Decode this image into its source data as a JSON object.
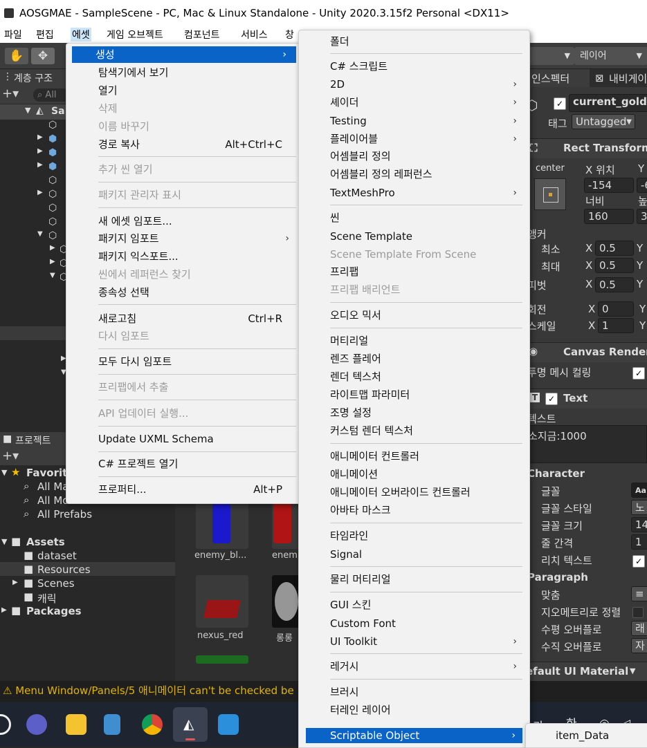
{
  "window": {
    "title": "AOSGMAE - SampleScene - PC, Mac & Linux Standalone - Unity 2020.3.15f2 Personal <DX11>"
  },
  "menubar": [
    "파일",
    "편집",
    "에셋",
    "게임 오브젝트",
    "컴포넌트",
    "서비스",
    "창"
  ],
  "toolbar": {
    "layers_label": "레이어"
  },
  "hierarchy": {
    "tab": "계층 구조",
    "search_placeholder": "All",
    "scene_name": "Sa"
  },
  "project": {
    "tab": "프로젝트",
    "favorites": "Favorit",
    "fav_items": [
      "All Ma",
      "All Models",
      "All Prefabs"
    ],
    "assets": "Assets",
    "asset_items": [
      "dataset",
      "Resources",
      "Scenes",
      "캐릭"
    ],
    "packages": "Packages",
    "thumbs": [
      "enemy_bl...",
      "enem",
      "nexus_red",
      "롱롱"
    ]
  },
  "status": {
    "message": "Menu Window/Panels/5 애니메이터  can't be checked be"
  },
  "inspector": {
    "tab_inspector": "인스펙터",
    "tab_navigation": "내비게이",
    "object_name": "current_gold",
    "tag_label": "태그",
    "tag_value": "Untagged",
    "rect_transform": "Rect Transform",
    "anchor_preset": "center",
    "pos_x_label": "X 위치",
    "pos_y_label": "Y",
    "pos_x": "-154",
    "pos_y": "-6",
    "width_label": "너비",
    "height_label": "높",
    "width": "160",
    "height": "3",
    "anchors": "앵커",
    "min": "최소",
    "max": "최대",
    "pivot": "피벗",
    "rotation": "회전",
    "scale": "스케일",
    "x_letter": "X",
    "y_letter": "Y",
    "anchor_min_x": "0.5",
    "anchor_max_x": "0.5",
    "pivot_x": "0.5",
    "rotation_x": "0",
    "scale_x": "1",
    "canvas_renderer": "Canvas Render",
    "cull_label": "투명 메시 컬링",
    "text_component": "Text",
    "text_label": "텍스트",
    "text_value": "소지금:1000",
    "character": "Character",
    "font": "글꼴",
    "font_value": "Aa",
    "font_style": "글꼴 스타일",
    "font_style_value": "노",
    "font_size": "글꼴 크기",
    "font_size_value": "14",
    "line_spacing": "줄 간격",
    "line_spacing_value": "1",
    "rich_text": "리치 텍스트",
    "paragraph": "Paragraph",
    "alignment": "맞춤",
    "geom_align": "지오메트리로 정렬",
    "h_overflow": "수평 오버플로",
    "h_overflow_value": "래",
    "v_overflow": "수직 오버플로",
    "v_overflow_value": "자",
    "material": "efault UI Material"
  },
  "asset_menu": {
    "items": [
      {
        "label": "생성",
        "arrow": true,
        "highlight": true
      },
      {
        "label": "탐색기에서 보기"
      },
      {
        "label": "열기"
      },
      {
        "label": "삭제",
        "disabled": true
      },
      {
        "label": "이름 바꾸기",
        "disabled": true
      },
      {
        "label": "경로 복사",
        "shortcut": "Alt+Ctrl+C"
      },
      {
        "label": "추가 씬 열기",
        "disabled": true
      },
      {
        "label": "패키지 관리자 표시",
        "disabled": true
      },
      {
        "label": "새 에셋 임포트..."
      },
      {
        "label": "패키지 임포트",
        "arrow": true
      },
      {
        "label": "패키지 익스포트..."
      },
      {
        "label": "씬에서 레퍼런스 찾기",
        "disabled": true
      },
      {
        "label": "종속성 선택"
      },
      {
        "label": "새로고침",
        "shortcut": "Ctrl+R"
      },
      {
        "label": "다시 임포트",
        "disabled": true
      },
      {
        "label": "모두 다시 임포트"
      },
      {
        "label": "프리팹에서 추출",
        "disabled": true
      },
      {
        "label": "API 업데이터 실행...",
        "disabled": true
      },
      {
        "label": "Update UXML Schema"
      },
      {
        "label": "C# 프로젝트 열기"
      },
      {
        "label": "프로퍼티...",
        "shortcut": "Alt+P"
      }
    ]
  },
  "create_menu": {
    "items": [
      {
        "label": "폴더"
      },
      {
        "label": "C# 스크립트"
      },
      {
        "label": "2D",
        "arrow": true
      },
      {
        "label": "셰이더",
        "arrow": true
      },
      {
        "label": "Testing",
        "arrow": true
      },
      {
        "label": "플레이어블",
        "arrow": true
      },
      {
        "label": "어셈블리 정의"
      },
      {
        "label": "어셈블리 정의 레퍼런스"
      },
      {
        "label": "TextMeshPro",
        "arrow": true
      },
      {
        "label": "씬"
      },
      {
        "label": "Scene Template"
      },
      {
        "label": "Scene Template From Scene",
        "disabled": true
      },
      {
        "label": "프리팹"
      },
      {
        "label": "프리팹 배리언트",
        "disabled": true
      },
      {
        "label": "오디오 믹서"
      },
      {
        "label": "머티리얼"
      },
      {
        "label": "렌즈 플레어"
      },
      {
        "label": "렌더 텍스처"
      },
      {
        "label": "라이트맵 파라미터"
      },
      {
        "label": "조명 설정"
      },
      {
        "label": "커스텀 렌더 텍스처"
      },
      {
        "label": "애니메이터 컨트롤러"
      },
      {
        "label": "애니메이션"
      },
      {
        "label": "애니메이터 오버라이드 컨트롤러"
      },
      {
        "label": "아바타 마스크"
      },
      {
        "label": "타임라인"
      },
      {
        "label": "Signal"
      },
      {
        "label": "물리 머티리얼"
      },
      {
        "label": "GUI 스킨"
      },
      {
        "label": "Custom Font"
      },
      {
        "label": "UI Toolkit",
        "arrow": true
      },
      {
        "label": "레거시",
        "arrow": true
      },
      {
        "label": "브러시"
      },
      {
        "label": "터레인 레이어"
      },
      {
        "label": "Scriptable Object",
        "arrow": true,
        "highlight": true
      }
    ]
  },
  "so_menu": {
    "items": [
      {
        "label": "item_Data"
      }
    ]
  },
  "taskbar": {
    "tray_a": "가",
    "tray_b": "한"
  },
  "colors": {
    "menu_highlight": "#0a64c8",
    "menu_bg": "#f2f2f2",
    "status_warn": "#e0b400"
  }
}
